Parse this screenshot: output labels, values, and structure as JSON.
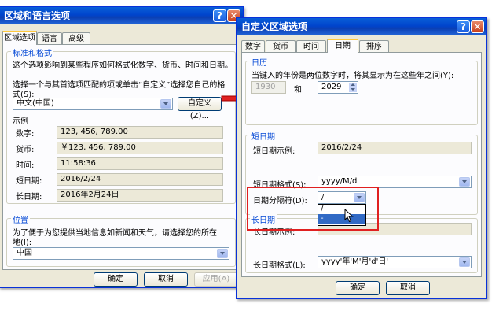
{
  "colors": {
    "accent": "#0046d5",
    "title_bar": "#0044cc",
    "highlight_box": "#e02020"
  },
  "left_window": {
    "title": "区域和语言选项",
    "tabs": [
      "区域选项",
      "语言",
      "高级"
    ],
    "standards_group": {
      "title": "标准和格式",
      "description": "这个选项影响到某些程序如何格式化数字、货币、时间和日期。",
      "instruction_line1": "选择一个与其首选项匹配的项或单击“自定义”选择您自己的格",
      "instruction_line2": "式(S):",
      "locale_value": "中文(中国)",
      "customize_button": "自定义(Z)...",
      "examples_label": "示例",
      "examples": [
        {
          "label": "数字:",
          "value": "123, 456, 789.00"
        },
        {
          "label": "货币:",
          "value": "￥123, 456, 789.00"
        },
        {
          "label": "时间:",
          "value": "11:58:36"
        },
        {
          "label": "短日期:",
          "value": "2016/2/24"
        },
        {
          "label": "长日期:",
          "value": "2016年2月24日"
        }
      ]
    },
    "location_group": {
      "title": "位置",
      "description_line1": "为了便于为您提供当地信息如新闻和天气，请选择您的所在",
      "description_line2": "地(I):",
      "location_value": "中国"
    },
    "buttons": {
      "ok": "确定",
      "cancel": "取消",
      "apply": "应用(A)"
    }
  },
  "right_window": {
    "title": "自定义区域选项",
    "tabs": [
      "数字",
      "货币",
      "时间",
      "日期",
      "排序"
    ],
    "calendar_group": {
      "title": "日历",
      "description": "当键入的年份是两位数字时，将其显示为在这些年之间(Y):",
      "year_from": "1930",
      "and_label": "和",
      "year_to": "2029"
    },
    "short_date_group": {
      "title": "短日期",
      "sample_label": "短日期示例:",
      "sample_value": "2016/2/24",
      "format_label": "短日期格式(S):",
      "format_value": "yyyy/M/d",
      "separator_label": "日期分隔符(D):",
      "separator_value": "/",
      "separator_options": [
        "/",
        "-"
      ]
    },
    "long_date_group": {
      "title": "长日期",
      "sample_label": "长日期示例:",
      "format_label": "长日期格式(L):",
      "format_value": "yyyy'年'M'月'd'日'"
    },
    "buttons": {
      "ok": "确定",
      "cancel": "取消"
    }
  }
}
